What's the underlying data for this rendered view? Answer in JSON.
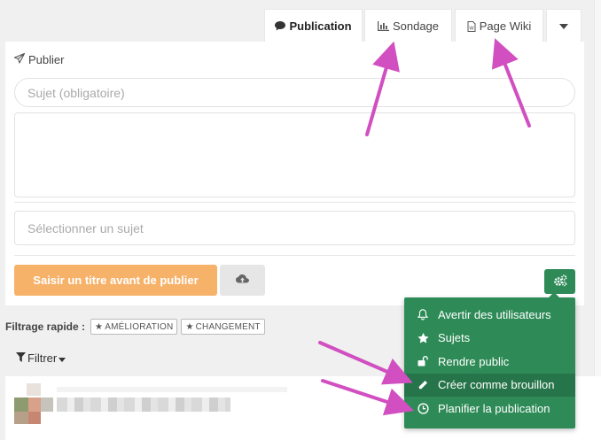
{
  "tabs": [
    {
      "label": "Publication",
      "icon": "comment-icon",
      "active": true
    },
    {
      "label": "Sondage",
      "icon": "bar-chart-icon",
      "active": false
    },
    {
      "label": "Page Wiki",
      "icon": "wiki-page-icon",
      "active": false
    }
  ],
  "composer": {
    "title": "Publier",
    "subject_placeholder": "Sujet (obligatoire)",
    "body_value": "",
    "topic_placeholder": "Sélectionner un sujet",
    "submit_label": "Saisir un titre avant de publier"
  },
  "quick_filter": {
    "label": "Filtrage rapide :",
    "tags": [
      "AMÉLIORATION",
      "CHANGEMENT"
    ]
  },
  "filter_button": "Filtrer",
  "options_menu": {
    "items": [
      {
        "label": "Avertir des utilisateurs",
        "icon": "bell-icon"
      },
      {
        "label": "Sujets",
        "icon": "star-icon"
      },
      {
        "label": "Rendre public",
        "icon": "unlock-icon"
      },
      {
        "label": "Créer comme brouillon",
        "icon": "pencil-icon"
      },
      {
        "label": "Planifier la publication",
        "icon": "clock-icon"
      }
    ]
  },
  "colors": {
    "accent_green": "#2e8b57",
    "submit_orange": "#f7b26a",
    "annotation_magenta": "#d14fc0"
  }
}
